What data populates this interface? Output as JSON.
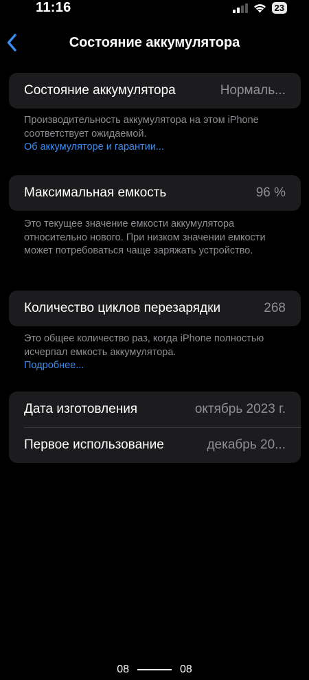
{
  "status_bar": {
    "time": "11:16",
    "battery_level": "23",
    "icons": [
      "cellular-signal-icon",
      "wifi-icon",
      "battery-icon"
    ]
  },
  "nav": {
    "back_icon": "chevron-left-icon",
    "title": "Состояние аккумулятора"
  },
  "battery_health": {
    "label": "Состояние аккумулятора",
    "value": "Нормаль...",
    "footnote": "Производительность аккумулятора на этом iPhone соответствует ожидаемой.",
    "link": "Об аккумуляторе и гарантии..."
  },
  "max_capacity": {
    "label": "Максимальная емкость",
    "value": "96 %",
    "footnote": "Это текущее значение емкости аккумулятора относительно нового. При низком значении емкости может потребоваться чаще заряжать устройство."
  },
  "cycle_count": {
    "label": "Количество циклов перезарядки",
    "value": "268",
    "footnote": "Это общее количество раз, когда iPhone полностью исчерпал емкость аккумулятора.",
    "link": "Подробнее..."
  },
  "dates": {
    "manufacture_label": "Дата изготовления",
    "manufacture_value": "октябрь 2023 г.",
    "first_use_label": "Первое использование",
    "first_use_value": "декабрь 20..."
  },
  "bottom": {
    "left": "08",
    "right": "08"
  },
  "colors": {
    "background": "#000000",
    "card": "#1c1c1e",
    "secondary_text": "#8e8e93",
    "link": "#3b8cf0",
    "accent": "#0a84ff"
  }
}
